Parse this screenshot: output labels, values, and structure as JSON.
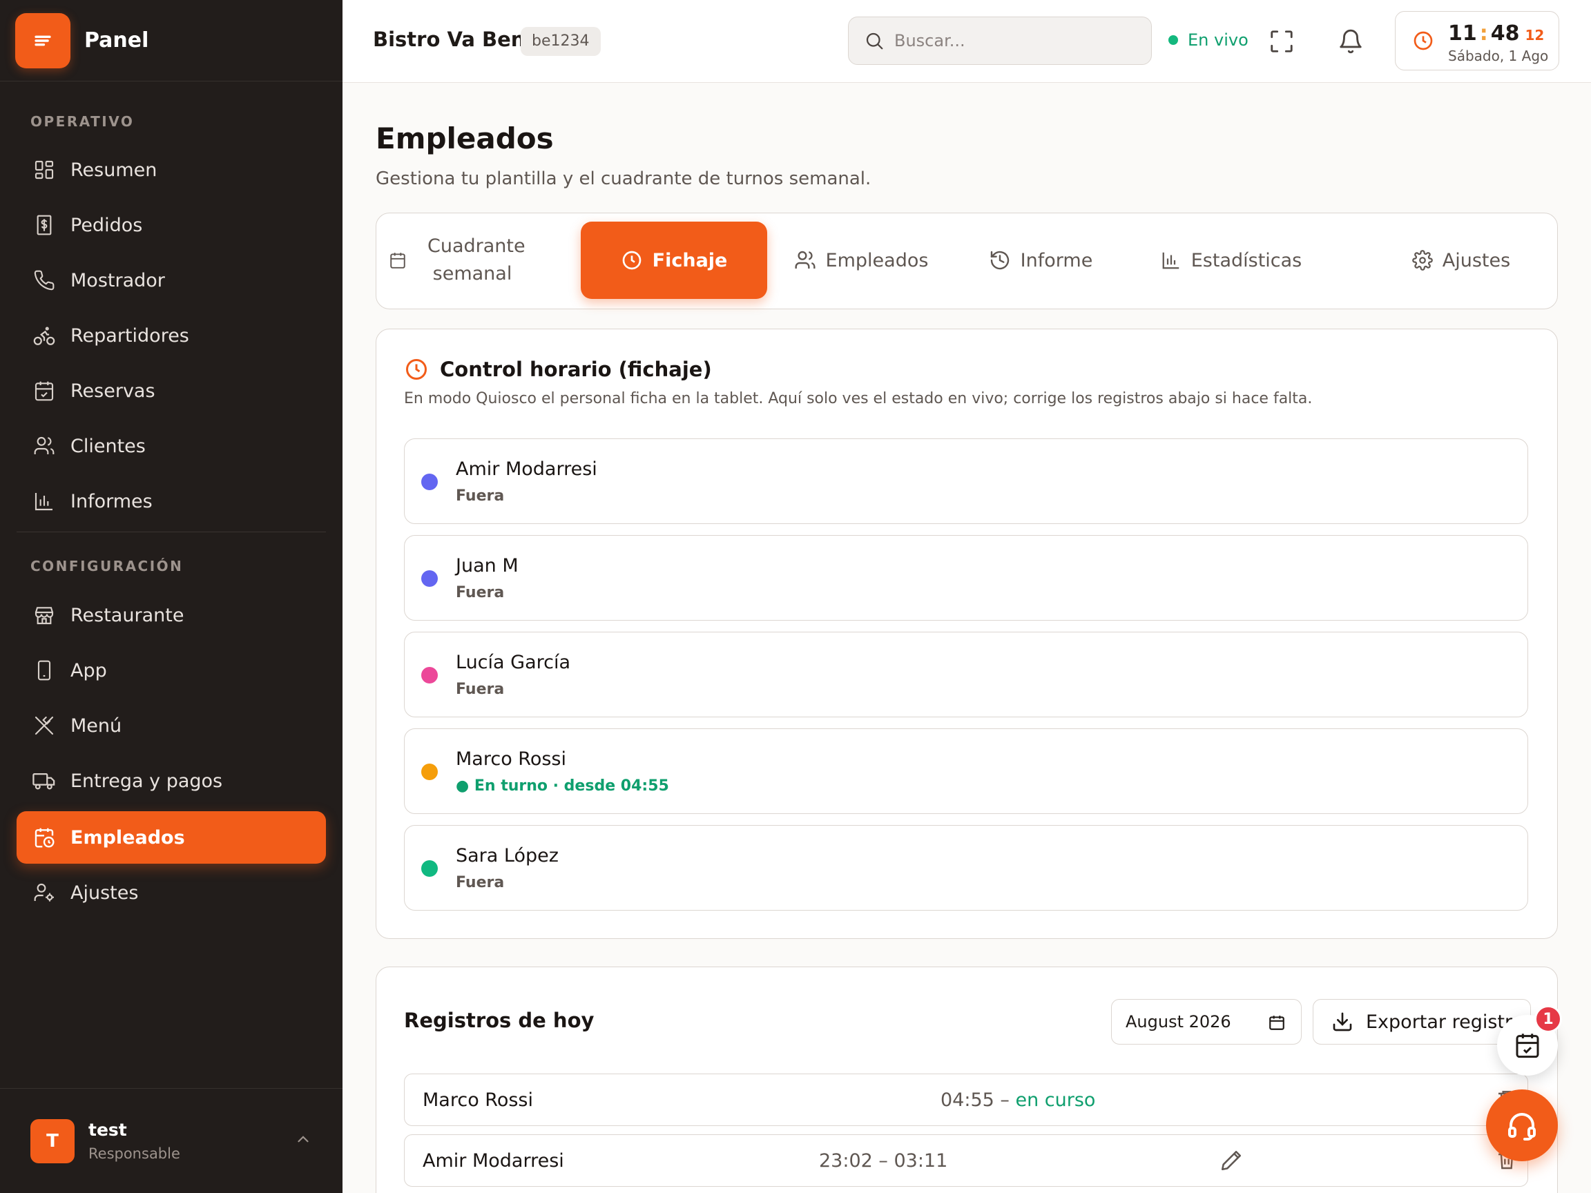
{
  "brand": {
    "title": "Panel",
    "icon": "menu-lines-icon"
  },
  "sidebar": {
    "section_operativo": "OPERATIVO",
    "section_config": "CONFIGURACIÓN",
    "operativo_items": [
      {
        "label": "Resumen",
        "icon": "dashboard-icon"
      },
      {
        "label": "Pedidos",
        "icon": "receipt-icon"
      },
      {
        "label": "Mostrador",
        "icon": "phone-icon"
      },
      {
        "label": "Repartidores",
        "icon": "bike-icon"
      },
      {
        "label": "Reservas",
        "icon": "calendar-check-icon"
      },
      {
        "label": "Clientes",
        "icon": "users-icon"
      },
      {
        "label": "Informes",
        "icon": "bar-chart-icon"
      }
    ],
    "config_items": [
      {
        "label": "Restaurante",
        "icon": "store-icon"
      },
      {
        "label": "App",
        "icon": "smartphone-icon"
      },
      {
        "label": "Menú",
        "icon": "utensils-icon"
      },
      {
        "label": "Entrega y pagos",
        "icon": "truck-icon"
      },
      {
        "label": "Empleados",
        "icon": "calendar-clock-icon",
        "active": true
      },
      {
        "label": "Ajustes",
        "icon": "user-cog-icon"
      }
    ],
    "user": {
      "initial": "T",
      "name": "test",
      "role": "Responsable"
    }
  },
  "topbar": {
    "restaurant": "Bistro Va Bene",
    "restaurant_id": "be1234",
    "search_placeholder": "Buscar...",
    "live_label": "En vivo",
    "clock": {
      "hours": "11",
      "sep": ":",
      "minutes": "48",
      "seconds": "12",
      "date": "Sábado, 1 Ago"
    }
  },
  "page": {
    "title": "Empleados",
    "subtitle": "Gestiona tu plantilla y el cuadrante de turnos semanal."
  },
  "tabs": [
    {
      "label": "Cuadrante semanal",
      "icon": "calendar-icon"
    },
    {
      "label": "Fichaje",
      "icon": "clock-icon",
      "active": true
    },
    {
      "label": "Empleados",
      "icon": "users-icon"
    },
    {
      "label": "Informe",
      "icon": "history-icon"
    },
    {
      "label": "Estadísticas",
      "icon": "bar-chart-icon"
    },
    {
      "label": "Ajustes",
      "icon": "gear-icon"
    }
  ],
  "fichaje": {
    "title": "Control horario (fichaje)",
    "description": "En modo Quiosco el personal ficha en la tablet. Aquí solo ves el estado en vivo; corrige los registros abajo si hace falta.",
    "employees": [
      {
        "name": "Amir Modarresi",
        "status": "Fuera",
        "color": "#6366f1",
        "on_shift": false
      },
      {
        "name": "Juan M",
        "status": "Fuera",
        "color": "#6366f1",
        "on_shift": false
      },
      {
        "name": "Lucía García",
        "status": "Fuera",
        "color": "#ec4899",
        "on_shift": false
      },
      {
        "name": "Marco Rossi",
        "status": "● En turno · desde 04:55",
        "color": "#f59e0b",
        "on_shift": true
      },
      {
        "name": "Sara López",
        "status": "Fuera",
        "color": "#10b981",
        "on_shift": false
      }
    ]
  },
  "registros": {
    "title": "Registros de hoy",
    "month_value": "August 2026",
    "export_label": "Exportar registros",
    "rows": [
      {
        "name": "Marco Rossi",
        "start": "04:55 – ",
        "status": "en curso"
      },
      {
        "name": "Amir Modarresi",
        "range": "23:02 – 03:11"
      }
    ]
  },
  "floating": {
    "notification_count": "1"
  },
  "colors": {
    "accent": "#f25c19",
    "sidebar_bg": "#221d1b",
    "success": "#0f9f6e"
  }
}
